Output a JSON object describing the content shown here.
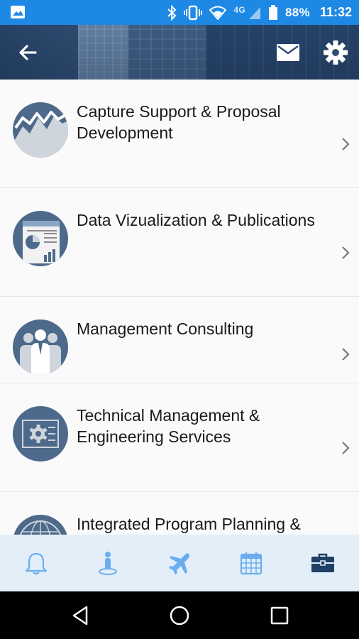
{
  "status_bar": {
    "network": "4G",
    "battery": "88%",
    "time": "11:32"
  },
  "header": {
    "back_icon": "arrow-left-icon",
    "mail_icon": "mail-icon",
    "settings_icon": "gear-icon"
  },
  "services": [
    {
      "title": "Capture Support & Proposal Development",
      "icon": "line-chart-icon"
    },
    {
      "title": "Data Vizualization & Publications",
      "icon": "report-chart-icon"
    },
    {
      "title": "Management Consulting",
      "icon": "people-icon"
    },
    {
      "title": "Technical Management & Engineering Services",
      "icon": "gear-circuit-icon"
    },
    {
      "title": "Integrated Program Planning &",
      "icon": "globe-icon"
    }
  ],
  "tabs": [
    {
      "icon": "bell-icon",
      "active": false
    },
    {
      "icon": "person-pin-icon",
      "active": false
    },
    {
      "icon": "airplane-icon",
      "active": false
    },
    {
      "icon": "calendar-icon",
      "active": false
    },
    {
      "icon": "briefcase-icon",
      "active": true
    }
  ],
  "colors": {
    "status_bar": "#1e88e5",
    "tab_bar": "#e3eef9",
    "tab_inactive": "#6aaef0",
    "tab_active": "#1f3f66",
    "avatar": "#4d6a8c"
  }
}
